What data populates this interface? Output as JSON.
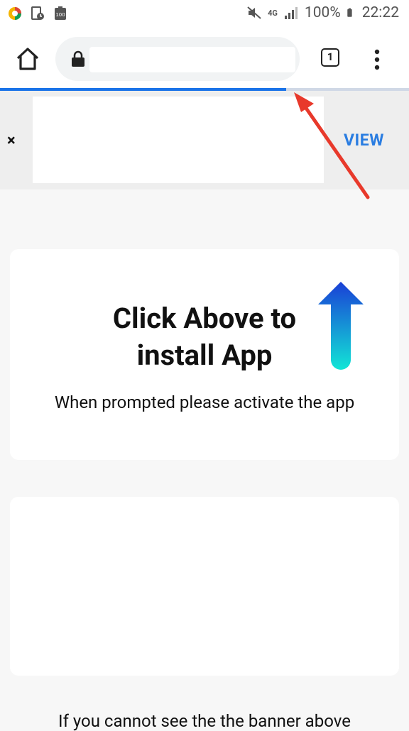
{
  "status_bar": {
    "battery_percent": "100%",
    "time": "22:22",
    "network": "4G"
  },
  "browser": {
    "url_value": "",
    "tab_count": "1",
    "load_progress_fraction": 0.7
  },
  "banner": {
    "close_label": "×",
    "view_label": "VIEW"
  },
  "card1": {
    "title_line1": "Click Above to",
    "title_line2": "install App",
    "subtitle": "When prompted please activate the app"
  },
  "footer": {
    "text": "If you cannot see the the banner above"
  },
  "colors": {
    "accent_blue": "#1a73e8",
    "view_blue": "#2a7de1",
    "annotation_red": "#e8392b"
  },
  "icons": [
    "home-icon",
    "lock-icon",
    "tabs-icon",
    "menu-icon",
    "up-arrow-icon"
  ]
}
